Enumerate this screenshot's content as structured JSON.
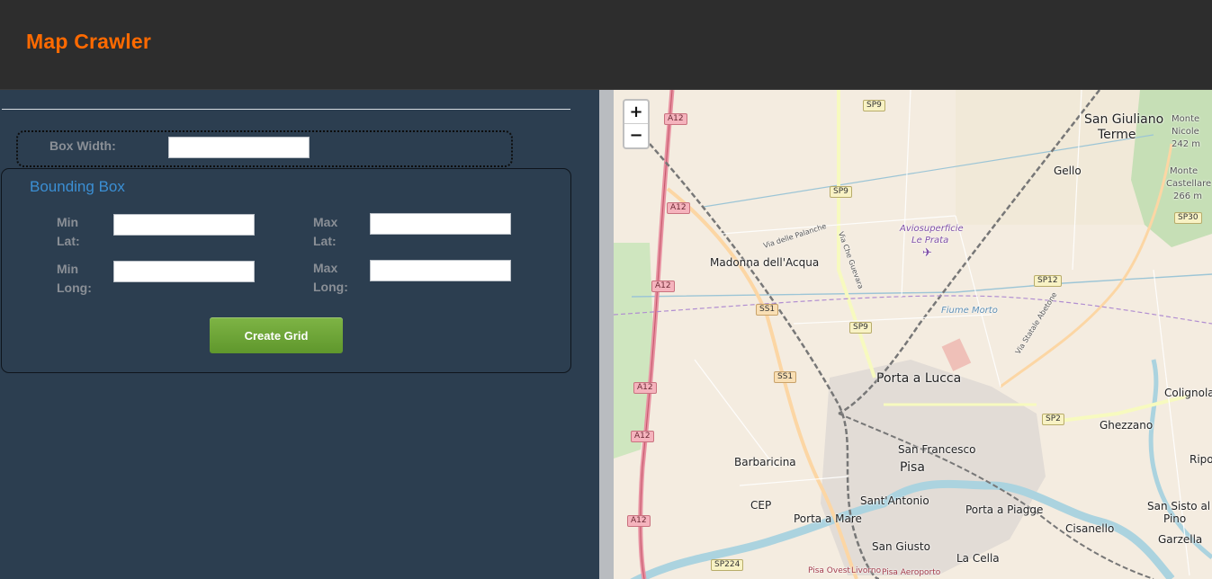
{
  "app": {
    "title": "Map Crawler"
  },
  "form": {
    "box_width_label": "Box Width:",
    "box_width_value": "",
    "bounding_box": {
      "legend": "Bounding Box",
      "min_lat_label": "Min Lat:",
      "max_lat_label": "Max Lat:",
      "min_long_label": "Min Long:",
      "max_long_label": "Max Long:",
      "min_lat_value": "",
      "max_lat_value": "",
      "min_long_value": "",
      "max_long_value": ""
    },
    "create_button": "Create Grid"
  },
  "map": {
    "zoom_in": "+",
    "zoom_out": "−",
    "places": {
      "san_giuliano_1": "San Giuliano",
      "san_giuliano_2": "Terme",
      "monte_nicole_1": "Monte",
      "monte_nicole_2": "Nicole",
      "monte_nicole_3": "242 m",
      "monte_castellare_1": "Monte",
      "monte_castellare_2": "Castellare",
      "monte_castellare_3": "266 m",
      "gello": "Gello",
      "avio_1": "Aviosuperficie",
      "avio_2": "Le Prata",
      "madonna": "Madonna dell'Acqua",
      "porta_lucca": "Porta a Lucca",
      "colignola": "Colignola",
      "ghezzano": "Ghezzano",
      "san_francesco": "San Francesco",
      "pisa": "Pisa",
      "barbaricina": "Barbaricina",
      "riglione": "Ripol",
      "santantonio": "Sant'Antonio",
      "cep": "CEP",
      "porta_mare": "Porta a Mare",
      "porta_piagge": "Porta a Piagge",
      "san_sisto_1": "San Sisto al",
      "san_sisto_2": "Pino",
      "cisanello": "Cisanello",
      "garzella": "Garzella",
      "san_giusto": "San Giusto",
      "la_cella": "La Cella",
      "fiume_morto": "Fiume Morto",
      "via_palanche": "Via delle Palanche",
      "via_guevara": "Via Che Guevara",
      "via_aurelia": "Via Statale Abetone",
      "pisa_ovest": "Pisa Ovest",
      "livorno": "Livorno",
      "pisa_aeroporto": "Pisa Aeroporto"
    },
    "shields": {
      "a12_1": "A12",
      "a12_2": "A12",
      "a12_3": "A12",
      "a12_4": "A12",
      "a12_5": "A12",
      "a12_6": "A12",
      "sp9_1": "SP9",
      "sp9_2": "SP9",
      "sp9_3": "SP9",
      "ss1_1": "SS1",
      "ss1_2": "SS1",
      "sp12": "SP12",
      "sp2": "SP2",
      "sp30": "SP30",
      "sp224": "SP224"
    }
  }
}
